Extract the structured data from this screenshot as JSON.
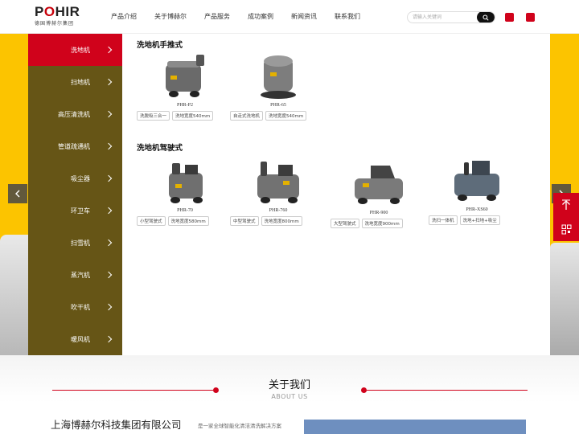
{
  "header": {
    "logo_text": "PHIR",
    "logo_sub": "德国博赫尔集团",
    "nav": [
      "产品介绍",
      "关于博赫尔",
      "产品服务",
      "成功案例",
      "新闻资讯",
      "联系我们"
    ],
    "search_placeholder": "请输入关键词"
  },
  "categories": [
    {
      "label": "洗地机",
      "active": true
    },
    {
      "label": "扫地机",
      "active": false
    },
    {
      "label": "高压清洗机",
      "active": false
    },
    {
      "label": "管道疏通机",
      "active": false
    },
    {
      "label": "吸尘器",
      "active": false
    },
    {
      "label": "环卫车",
      "active": false
    },
    {
      "label": "扫雪机",
      "active": false
    },
    {
      "label": "蒸汽机",
      "active": false
    },
    {
      "label": "吹干机",
      "active": false
    },
    {
      "label": "暖风机",
      "active": false
    }
  ],
  "sections": [
    {
      "title": "洗地机手推式",
      "products": [
        {
          "name": "PHR-P2",
          "tags": [
            "洗脱吸三合一",
            "洗地宽度540mm"
          ]
        },
        {
          "name": "PHR-65",
          "tags": [
            "自走式洗地机",
            "洗地宽度540mm"
          ]
        }
      ]
    },
    {
      "title": "洗地机驾驶式",
      "products": [
        {
          "name": "PHR-70",
          "tags": [
            "小型驾驶式",
            "洗地宽度580mm"
          ]
        },
        {
          "name": "PHR-760",
          "tags": [
            "中型驾驶式",
            "洗地宽度800mm"
          ]
        },
        {
          "name": "PHR-900",
          "tags": [
            "大型驾驶式",
            "洗地宽度900mm"
          ]
        },
        {
          "name": "PHR-XS60",
          "tags": [
            "洗扫一体机",
            "洗地+扫地+吸尘"
          ]
        }
      ]
    }
  ],
  "about": {
    "title": "关于我们",
    "subtitle": "ABOUT US",
    "company": "上海博赫尔科技集团有限公司",
    "desc": "是一家全球智能化清洁清洗解决方案"
  },
  "colors": {
    "brand_red": "#d0021b",
    "banner_yellow": "#fcc400",
    "menu_brown": "#665516"
  }
}
